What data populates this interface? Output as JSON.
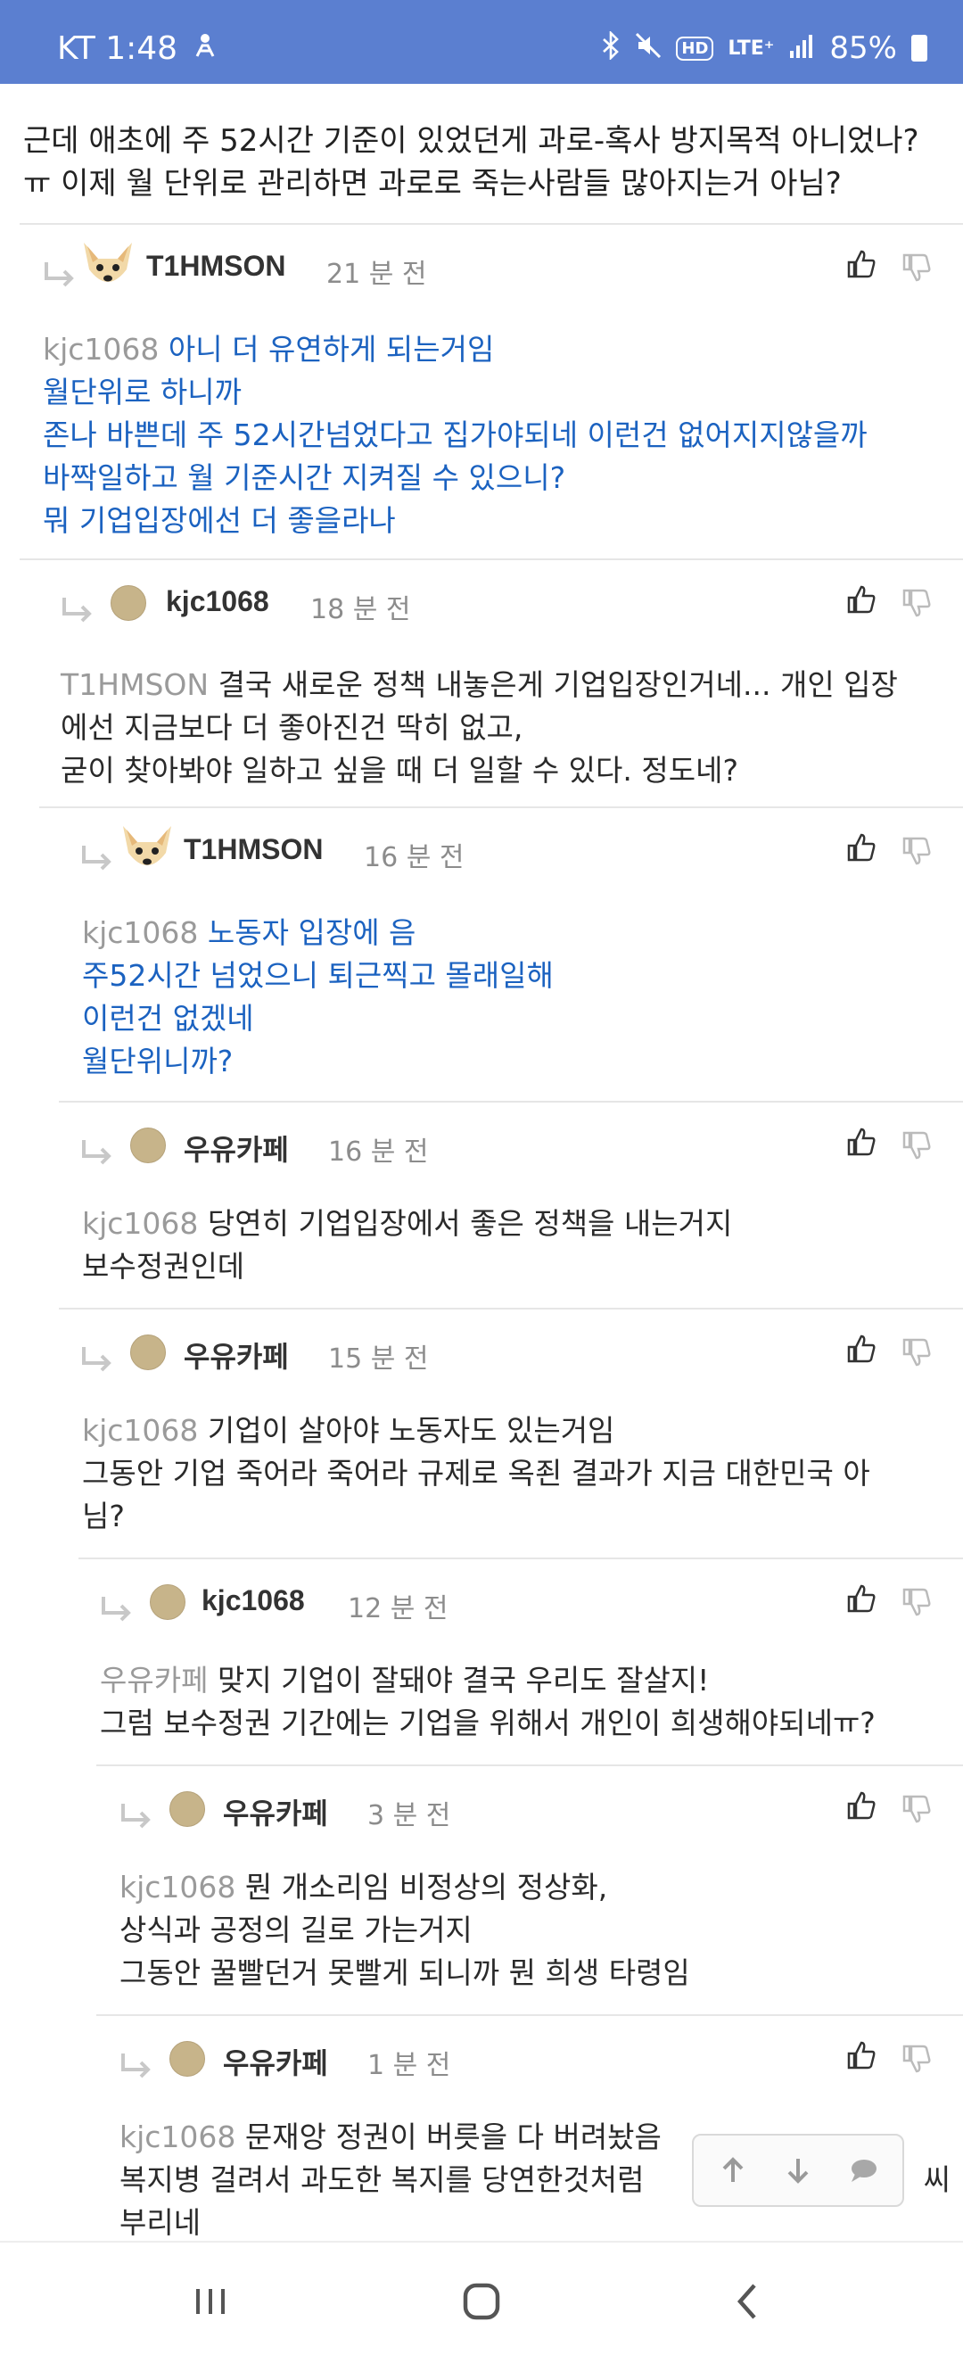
{
  "status_bar": {
    "carrier_time": "KT 1:48",
    "battery": "85%",
    "network": "LTE⁺",
    "hd": "HD",
    "icons": [
      "person-activity-icon",
      "bluetooth-icon",
      "mute-icon",
      "hd-voice-icon",
      "lte-icon",
      "signal-icon",
      "battery-icon"
    ]
  },
  "post": {
    "line1": "근데 애초에 주 52시간 기준이 있었던게 과로-혹사 방지목적 아니었나?",
    "line2": "ㅠ 이제 월 단위로 관리하면 과로로 죽는사람들 많아지는거 아님?"
  },
  "comments": [
    {
      "author": "T1HMSON",
      "time": "21 분 전",
      "avatar": "dog-avatar",
      "mention": "kjc1068",
      "lines": [
        "아니 더 유연하게 되는거임",
        "월단위로 하니까",
        "존나 바쁜데 주 52시간넘었다고 집가야되네 이런건 없어지지않을까",
        "바짝일하고 월 기준시간 지켜질 수 있으니?",
        "뭐 기업입장에선 더 좋을라나"
      ]
    },
    {
      "author": "kjc1068",
      "time": "18 분 전",
      "avatar": "circle-avatar",
      "mention": "T1HMSON",
      "lines": [
        "결국 새로운 정책 내놓은게 기업입장인거네... 개인 입장",
        "에선 지금보다 더 좋아진건 딱히 없고,",
        "굳이 찾아봐야 일하고 싶을 때 더 일할 수 있다. 정도네?"
      ]
    },
    {
      "author": "T1HMSON",
      "time": "16 분 전",
      "avatar": "dog-avatar",
      "mention": "kjc1068",
      "lines": [
        "노동자 입장에 음",
        "주52시간 넘었으니 퇴근찍고 몰래일해",
        "이런건 없겠네",
        "월단위니까?"
      ]
    },
    {
      "author": "우유카페",
      "time": "16 분 전",
      "avatar": "circle-avatar",
      "mention": "kjc1068",
      "lines": [
        "당연히 기업입장에서 좋은 정책을 내는거지",
        "보수정권인데"
      ]
    },
    {
      "author": "우유카페",
      "time": "15 분 전",
      "avatar": "circle-avatar",
      "mention": "kjc1068",
      "lines": [
        "기업이 살아야 노동자도 있는거임",
        "그동안 기업 죽어라 죽어라 규제로 옥죈 결과가 지금 대한민국 아",
        "님?"
      ]
    },
    {
      "author": "kjc1068",
      "time": "12 분 전",
      "avatar": "circle-avatar",
      "mention": "우유카페",
      "lines": [
        "맞지 기업이 잘돼야 결국 우리도 잘살지!",
        "그럼 보수정권 기간에는 기업을 위해서 개인이 희생해야되네ㅠ?"
      ]
    },
    {
      "author": "우유카페",
      "time": "3 분 전",
      "avatar": "circle-avatar",
      "mention": "kjc1068",
      "lines": [
        "뭔 개소리임 비정상의 정상화,",
        "상식과 공정의 길로 가는거지",
        "그동안 꿀빨던거 못빨게 되니까 뭔 희생 타령임"
      ]
    },
    {
      "author": "우유카페",
      "time": "1 분 전",
      "avatar": "circle-avatar",
      "mention": "kjc1068",
      "lines": [
        "문재앙 정권이 버릇을 다 버려놨음",
        "복지병 걸려서 과도한 복지를 당연한것처럼",
        "부리네"
      ],
      "line_suffix": "씨"
    }
  ],
  "float_nav": {
    "icons": [
      "arrow-up-icon",
      "arrow-down-icon",
      "chat-bubble-icon"
    ]
  },
  "nav_bar": {
    "icons": [
      "recent-apps-icon",
      "home-icon",
      "back-icon"
    ]
  },
  "colors": {
    "status_bar": "#5b7fd0",
    "reply_text_blue": "#1b62c0",
    "mention_gray": "#9a9a9a"
  }
}
